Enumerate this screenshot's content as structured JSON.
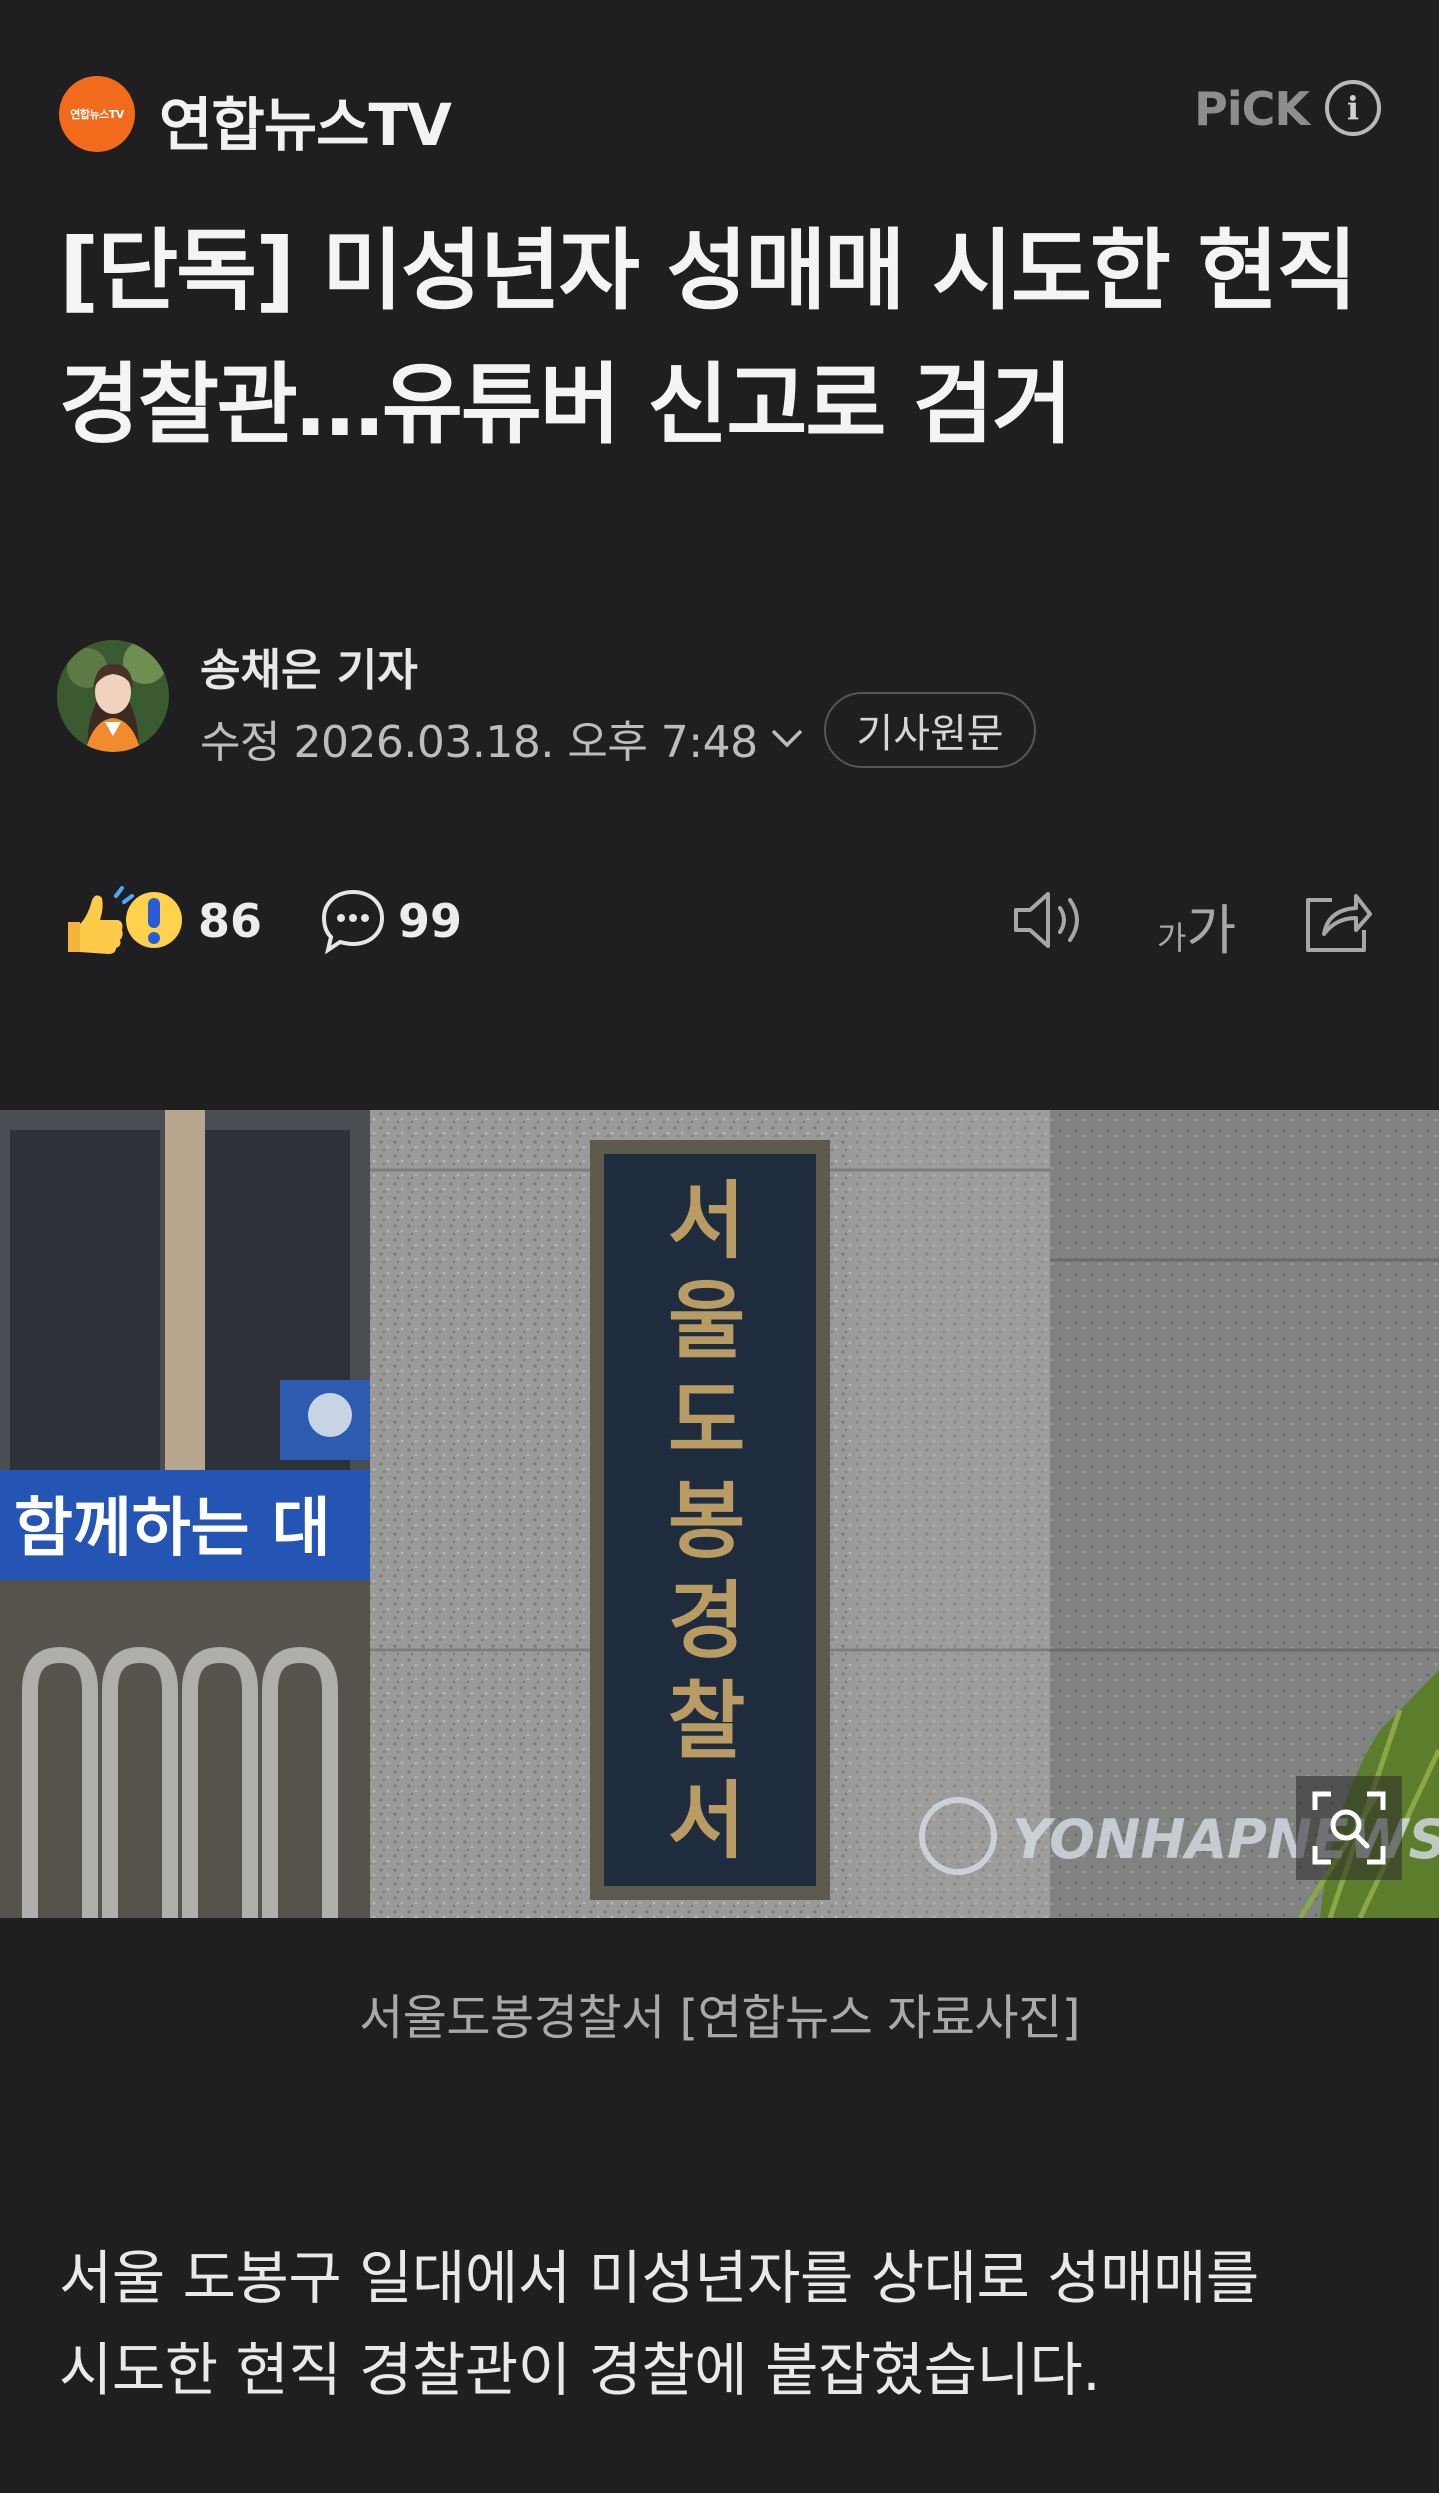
{
  "press": {
    "logo_text": "연합뉴스TV",
    "name": "연합뉴스TV",
    "pick_label": "PiCK",
    "info_icon": "info-icon"
  },
  "article": {
    "headline": "[단독] 미성년자 성매매 시도한 현직 경찰관…유튜버 신고로 검거",
    "reporter": "송채은 기자",
    "timestamp": "수정 2026.03.18. 오후 7:48",
    "original_button": "기사원문",
    "photo": {
      "sign_text": "서울도봉경찰서",
      "banner_text": "함께하는 대",
      "watermark": "YONHAPNEWS"
    },
    "caption": "서울도봉경찰서 [연합뉴스 자료사진]",
    "body": "서울 도봉구 일대에서 미성년자를 상대로 성매매를 시도한 현직 경찰관이 경찰에 붙잡혔습니다."
  },
  "reactions": {
    "reaction_count": "86",
    "comment_count": "99",
    "font_size_small": "가",
    "font_size_big": "가"
  },
  "icons": {
    "reaction": "thumbs-up-surprise-icon",
    "comment": "speech-bubble-icon",
    "tts": "speaker-icon",
    "font": "font-size-icon",
    "share": "share-icon",
    "zoom": "zoom-icon",
    "chevron": "chevron-down-icon"
  },
  "colors": {
    "background": "#1f1f21",
    "brand": "#f26a1b"
  }
}
